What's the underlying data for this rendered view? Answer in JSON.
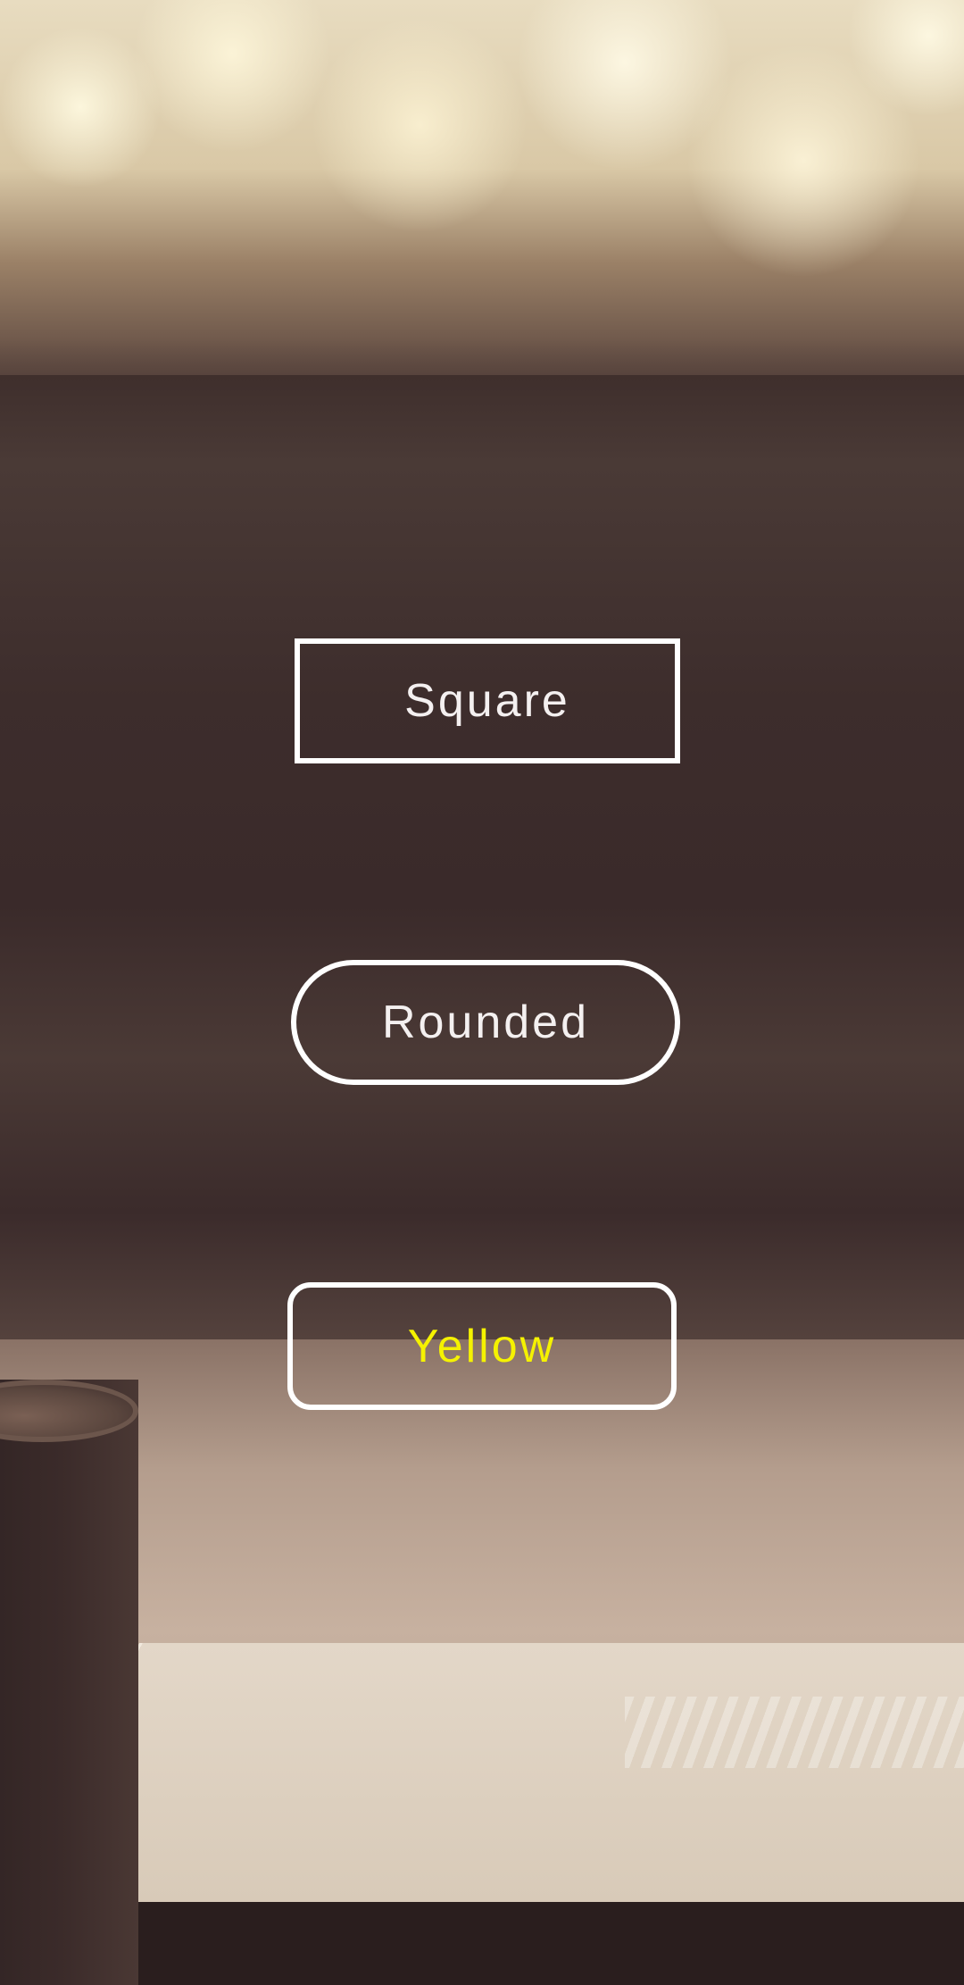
{
  "background": {
    "description_icon": "coffee-and-book-photo"
  },
  "buttons": {
    "square": {
      "label": "Square",
      "text_color": "#f4f0f0"
    },
    "rounded": {
      "label": "Rounded",
      "text_color": "#f4f0f0"
    },
    "yellow": {
      "label": "Yellow",
      "text_color": "#f5f200"
    }
  },
  "colors": {
    "border": "#ffffff"
  }
}
